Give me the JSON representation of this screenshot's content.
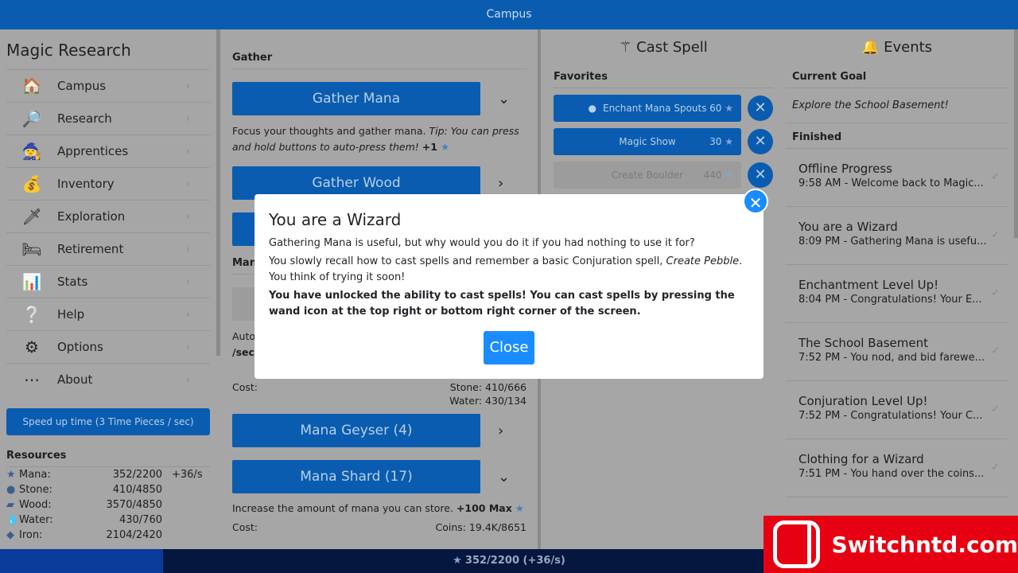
{
  "topbar": {
    "title": "Campus"
  },
  "sidebar": {
    "title": "Magic Research",
    "items": [
      {
        "label": "Campus",
        "icon": "🏠"
      },
      {
        "label": "Research",
        "icon": "🔎"
      },
      {
        "label": "Apprentices",
        "icon": "🧙"
      },
      {
        "label": "Inventory",
        "icon": "💰"
      },
      {
        "label": "Exploration",
        "icon": "🗡"
      },
      {
        "label": "Retirement",
        "icon": "🛏"
      },
      {
        "label": "Stats",
        "icon": "📊"
      },
      {
        "label": "Help",
        "icon": "❔"
      },
      {
        "label": "Options",
        "icon": "⚙"
      },
      {
        "label": "About",
        "icon": "⋯"
      }
    ],
    "speed_button": "Speed up time (3 Time Pieces / sec)",
    "resources_title": "Resources",
    "resources": [
      {
        "name": "Mana:",
        "value": "352/2200",
        "rate": "+36/s",
        "icon": "★"
      },
      {
        "name": "Stone:",
        "value": "410/4850",
        "rate": "",
        "icon": "●"
      },
      {
        "name": "Wood:",
        "value": "3570/4850",
        "rate": "",
        "icon": "▰"
      },
      {
        "name": "Water:",
        "value": "430/760",
        "rate": "",
        "icon": "💧"
      },
      {
        "name": "Iron:",
        "value": "2104/2420",
        "rate": "",
        "icon": "◆"
      }
    ]
  },
  "gather": {
    "title": "Gather",
    "gather_mana": "Gather Mana",
    "desc": "Focus your thoughts and gather mana.",
    "tip": "Tip: You can press and hold buttons to auto-press them!",
    "gain": "+1",
    "gather_wood": "Gather Wood",
    "partial_heading": "Man",
    "auto_partial": "Auto",
    "sec_partial": "/sec",
    "cost_label": "Cost:",
    "stone_cost_partial": "Stone: 410/666",
    "water_cost": "Water: 430/134",
    "mana_geyser": "Mana Geyser (4)",
    "mana_shard": "Mana Shard (17)",
    "shard_desc": "Increase the amount of mana you can store.",
    "shard_gain": "+100 Max",
    "shard_cost": "Coins: 19.4K/8651"
  },
  "cast": {
    "title": "Cast Spell",
    "favorites_title": "Favorites",
    "favorites": [
      {
        "label": "Enchant Mana Spouts",
        "cost": "60",
        "enabled": true,
        "active": true
      },
      {
        "label": "Magic Show",
        "cost": "30",
        "enabled": true,
        "active": false
      },
      {
        "label": "Create Boulder",
        "cost": "440",
        "enabled": false,
        "active": false
      }
    ]
  },
  "events": {
    "title": "Events",
    "goal_title": "Current Goal",
    "goal": "Explore the School Basement!",
    "finished_title": "Finished",
    "items": [
      {
        "title": "Offline Progress",
        "sub": "9:58 AM - Welcome back to Magic..."
      },
      {
        "title": "You are a Wizard",
        "sub": "8:09 PM - Gathering Mana is usefu..."
      },
      {
        "title": "Enchantment Level Up!",
        "sub": "8:04 PM - Congratulations! Your E..."
      },
      {
        "title": "The School Basement",
        "sub": "7:52 PM - You nod, and bid farewe..."
      },
      {
        "title": "Conjuration Level Up!",
        "sub": "7:52 PM - Congratulations! Your C..."
      },
      {
        "title": "Clothing for a Wizard",
        "sub": "7:51 PM - You hand over the coins..."
      }
    ]
  },
  "bottombar": {
    "text": "352/2200 (+36/s)",
    "mana_fraction": 0.16
  },
  "modal": {
    "title": "You are a Wizard",
    "p1": "Gathering Mana is useful, but why would you do it if you had nothing to use it for?",
    "p2a": "You slowly recall how to cast spells and remember a basic Conjuration spell, ",
    "p2spell": "Create Pebble",
    "p2b": ". You think of trying it soon!",
    "p3": "You have unlocked the ability to cast spells! You can cast spells by pressing the wand icon at the top right or bottom right corner of the screen.",
    "close": "Close"
  },
  "watermark": {
    "text": "Switchntd.com"
  },
  "colors": {
    "accent": "#1a8cff",
    "topbar": "#0a5cb0",
    "watermark": "#e60012"
  }
}
